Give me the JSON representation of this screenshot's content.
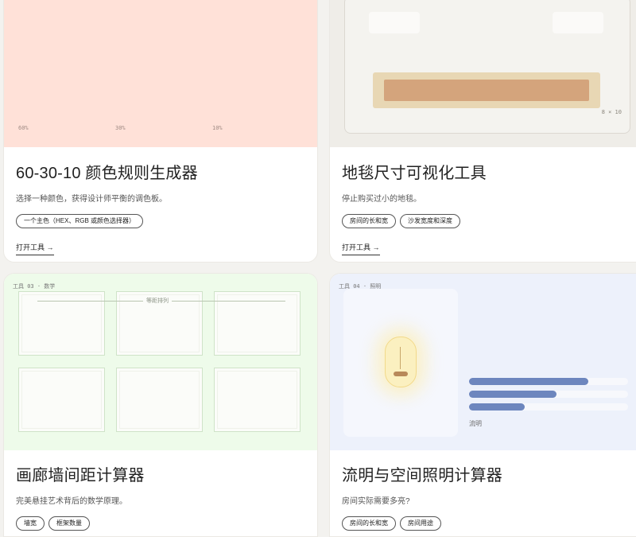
{
  "cards": [
    {
      "title": "60-30-10 颜色规则生成器",
      "description": "选择一种颜色，获得设计师平衡的调色板。",
      "tags": [
        "一个主色（HEX、RGB 或颜色选择器）"
      ],
      "cta": "打开工具 →",
      "preview": {
        "labels": [
          "60%",
          "30%",
          "10%"
        ],
        "bg": "#ffe1d8"
      }
    },
    {
      "title": "地毯尺寸可视化工具",
      "description": "停止购买过小的地毯。",
      "tags": [
        "房间的长和宽",
        "沙发宽度和深度"
      ],
      "cta": "打开工具 →",
      "preview": {
        "dimension": "8 × 10",
        "rug_color": "#d4a47c"
      }
    },
    {
      "title": "画廊墙间距计算器",
      "description": "完美悬挂艺术背后的数学原理。",
      "tags": [
        "墙宽",
        "框架数量"
      ],
      "preview": {
        "kicker": "工具 03 · 数学",
        "ruler_label": "等距排列",
        "bg": "#eefbea"
      }
    },
    {
      "title": "流明与空间照明计算器",
      "description": "房间实际需要多亮?",
      "tags": [
        "房间的长和宽",
        "房间用途"
      ],
      "preview": {
        "kicker": "工具 04 · 照明",
        "bar_label": "流明",
        "bar_color": "#6d86be",
        "bars": [
          0.75,
          0.55,
          0.35
        ],
        "bg": "#edf1fb"
      }
    }
  ]
}
